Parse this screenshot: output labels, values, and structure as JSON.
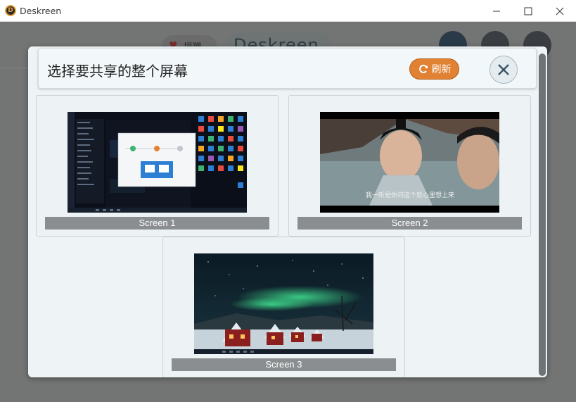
{
  "window": {
    "title": "Deskreen",
    "logo_letter": "D"
  },
  "background_app": {
    "donate_label": "捐赠",
    "brand": "Deskreen"
  },
  "modal": {
    "title": "选择要共享的整个屏幕",
    "refresh_label": "刷新",
    "screens": [
      {
        "label": "Screen 1"
      },
      {
        "label": "Screen 2"
      },
      {
        "label": "Screen 3"
      }
    ],
    "screen2_subtitle": "我一听是你问这个就心里想上来"
  },
  "colors": {
    "accent": "#e18133",
    "modal_bg": "#eef3f5",
    "overlay": "#737474"
  }
}
